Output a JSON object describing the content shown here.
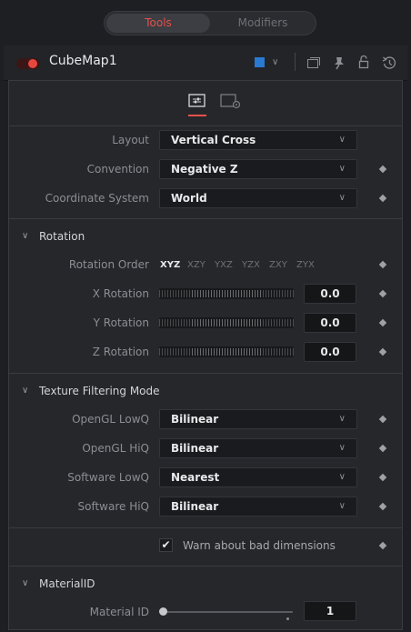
{
  "tabs": {
    "tools": "Tools",
    "modifiers": "Modifiers"
  },
  "header": {
    "tool_name": "CubeMap1",
    "color_swatch": "#2a7ad1"
  },
  "settings": [
    {
      "label": "Layout",
      "value": "Vertical Cross"
    },
    {
      "label": "Convention",
      "value": "Negative Z"
    },
    {
      "label": "Coordinate System",
      "value": "World"
    }
  ],
  "rotation": {
    "title": "Rotation",
    "order_label": "Rotation Order",
    "orders": [
      "XYZ",
      "XZY",
      "YXZ",
      "YZX",
      "ZXY",
      "ZYX"
    ],
    "selected_order": "XYZ",
    "x_label": "X Rotation",
    "x_value": "0.0",
    "y_label": "Y Rotation",
    "y_value": "0.0",
    "z_label": "Z Rotation",
    "z_value": "0.0"
  },
  "filtering": {
    "title": "Texture Filtering Mode",
    "rows": [
      {
        "label": "OpenGL LowQ",
        "value": "Bilinear"
      },
      {
        "label": "OpenGL HiQ",
        "value": "Bilinear"
      },
      {
        "label": "Software LowQ",
        "value": "Nearest"
      },
      {
        "label": "Software HiQ",
        "value": "Bilinear"
      }
    ]
  },
  "warn": {
    "label": "Warn about bad dimensions",
    "checked": true
  },
  "material": {
    "title": "MaterialID",
    "label": "Material ID",
    "value": "1"
  }
}
